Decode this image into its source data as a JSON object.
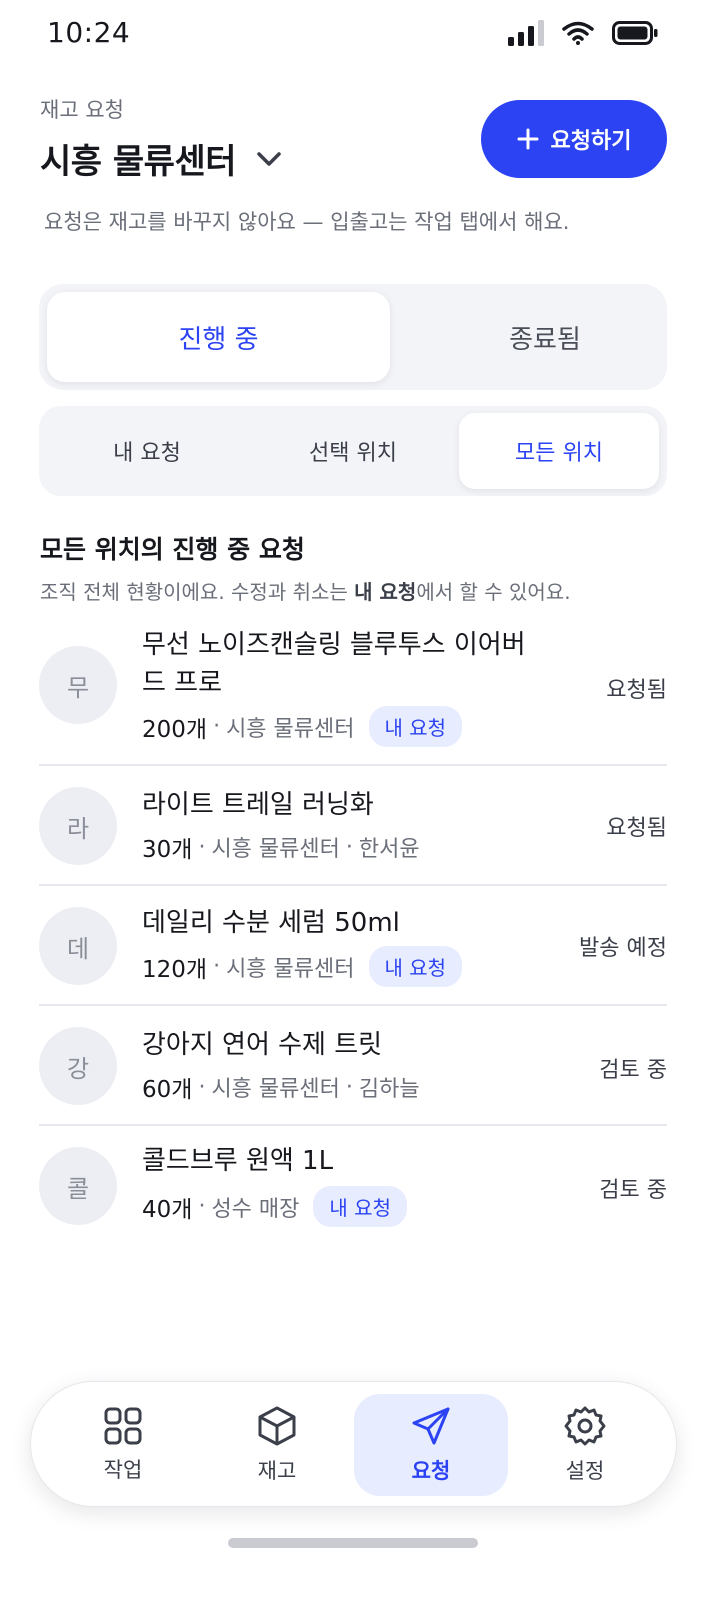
{
  "status_bar": {
    "time": "10:24"
  },
  "header": {
    "eyebrow": "재고 요청",
    "location": "시흥 물류센터",
    "new_request_label": "요청하기",
    "note": "요청은 재고를 바꾸지 않아요 — 입출고는 작업 탭에서 해요."
  },
  "status_tabs": {
    "active": "진행 중",
    "inactive": "종료됨"
  },
  "scope_tabs": {
    "mine": "내 요청",
    "selected": "선택 위치",
    "all": "모든 위치"
  },
  "section": {
    "title": "모든 위치의 진행 중 요청",
    "desc_prefix": "조직 전체 현황이에요. 수정과 취소는 ",
    "desc_bold": "내 요청",
    "desc_suffix": "에서 할 수 있어요."
  },
  "requests": [
    {
      "initial": "무",
      "name": "무선 노이즈캔슬링 블루투스 이어버드 프로",
      "qty": "200개",
      "location": "시흥 물류센터",
      "requester": "",
      "badge": "내 요청",
      "status": "요청됨"
    },
    {
      "initial": "라",
      "name": "라이트 트레일 러닝화",
      "qty": "30개",
      "location": "시흥 물류센터",
      "requester": "한서윤",
      "badge": "",
      "status": "요청됨"
    },
    {
      "initial": "데",
      "name": "데일리 수분 세럼 50ml",
      "qty": "120개",
      "location": "시흥 물류센터",
      "requester": "",
      "badge": "내 요청",
      "status": "발송 예정"
    },
    {
      "initial": "강",
      "name": "강아지 연어 수제 트릿",
      "qty": "60개",
      "location": "시흥 물류센터",
      "requester": "김하늘",
      "badge": "",
      "status": "검토 중"
    },
    {
      "initial": "콜",
      "name": "콜드브루 원액 1L",
      "qty": "40개",
      "location": "성수 매장",
      "requester": "",
      "badge": "내 요청",
      "status": "검토 중"
    }
  ],
  "tabbar": {
    "work": "작업",
    "inventory": "재고",
    "requests": "요청",
    "settings": "설정"
  },
  "colors": {
    "accent": "#2b43f3",
    "accent_soft": "#e7ecfe"
  }
}
